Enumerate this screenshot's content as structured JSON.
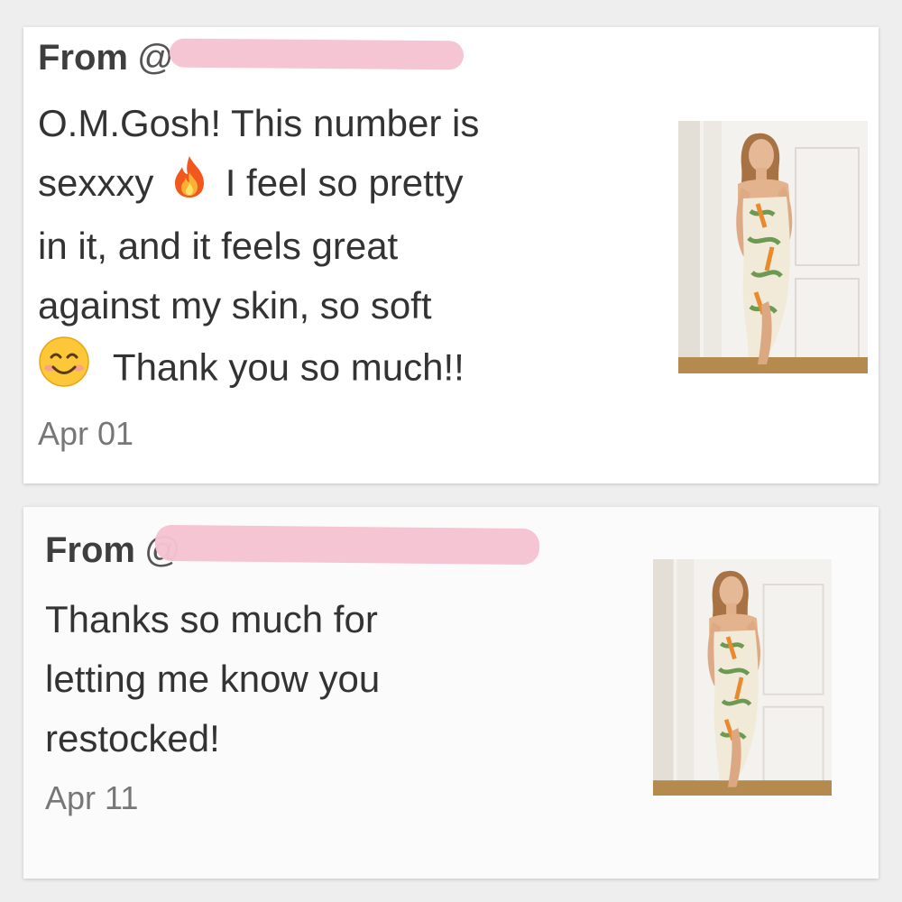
{
  "reviews": [
    {
      "from_label": "From",
      "handle_prefix": "@",
      "message_lines": [
        "O.M.Gosh! This number is",
        "sexxxy",
        "I feel so pretty",
        "in it, and it feels great",
        "against my skin, so soft",
        "Thank you so much!!"
      ],
      "date": "Apr 01",
      "emojis": [
        "fire-emoji",
        "smiling-face-emoji"
      ],
      "photo": "model-wearing-floral-strapless-dress"
    },
    {
      "from_label": "From",
      "handle_prefix": "@",
      "message_lines": [
        "Thanks so much for",
        "letting me know you",
        "restocked!"
      ],
      "date": "Apr 11",
      "photo": "model-wearing-floral-strapless-dress"
    }
  ],
  "colors": {
    "redaction": "#f6c3d3",
    "text": "#333333",
    "date": "#777777",
    "card_background": "#ffffff",
    "page_background": "#eeeeee"
  }
}
